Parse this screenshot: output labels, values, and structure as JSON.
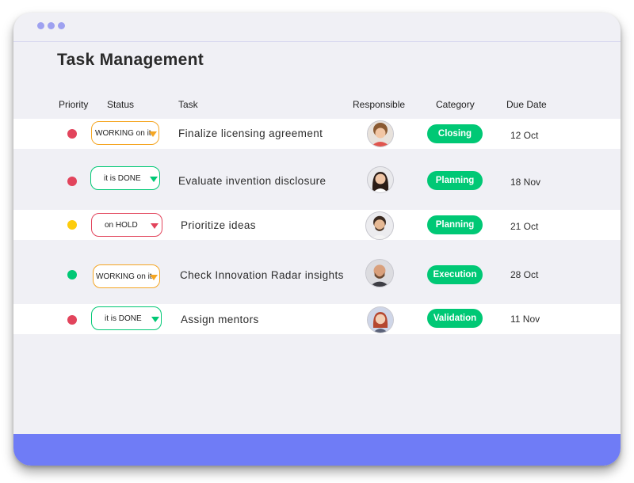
{
  "page_title": "Task Management",
  "columns": {
    "priority": "Priority",
    "status": "Status",
    "task": "Task",
    "responsible": "Responsible",
    "category": "Category",
    "due_date": "Due Date"
  },
  "colors": {
    "accent": "#6f7cf6",
    "window_dots": "#9ea1f0",
    "category_green": "#00c875",
    "priority_red": "#e2445c",
    "priority_yellow": "#fdcc0c",
    "priority_green": "#00c875",
    "status_working_border": "#f5a623",
    "status_done_border": "#00c875",
    "status_hold_border": "#e2445c"
  },
  "tasks": [
    {
      "priority": "high",
      "priority_color": "#e2445c",
      "status": "WORKING on it",
      "task": "Finalize licensing agreement",
      "responsible_avatar": "avatar-curly-hair-icon",
      "category": "Closing",
      "due": "12 Oct"
    },
    {
      "priority": "high",
      "priority_color": "#e2445c",
      "status": "it is DONE",
      "task": "Evaluate invention disclosure",
      "responsible_avatar": "avatar-woman-dark-hair-icon",
      "category": "Planning",
      "due": "18 Nov"
    },
    {
      "priority": "medium",
      "priority_color": "#fdcc0c",
      "status": "on HOLD",
      "task": "Prioritize ideas",
      "responsible_avatar": "avatar-bearded-man-icon",
      "category": "Planning",
      "due": "21 Oct"
    },
    {
      "priority": "low",
      "priority_color": "#00c875",
      "status": "WORKING on it",
      "task": "Check Innovation Radar insights",
      "responsible_avatar": "avatar-bald-man-icon",
      "category": "Execution",
      "due": "28 Oct"
    },
    {
      "priority": "high",
      "priority_color": "#e2445c",
      "status": "it is DONE",
      "task": "Assign mentors",
      "responsible_avatar": "avatar-red-hair-woman-icon",
      "category": "Validation",
      "due": "11 Nov"
    }
  ]
}
